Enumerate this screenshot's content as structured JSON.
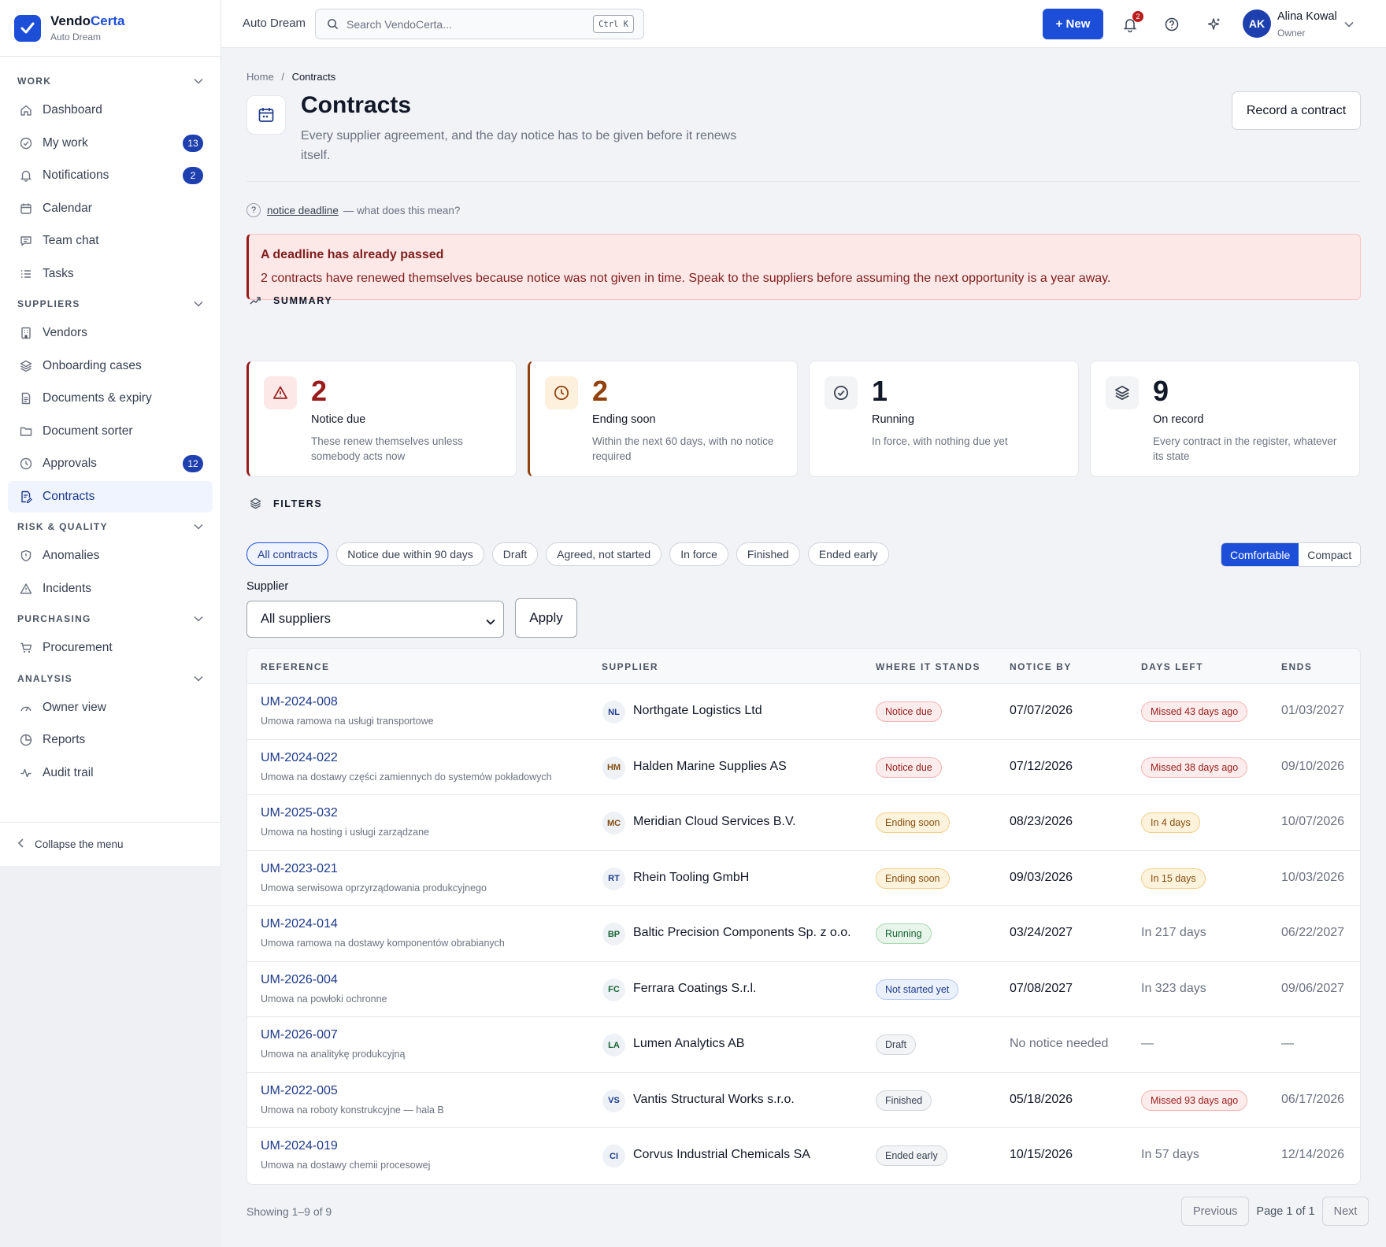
{
  "brand": {
    "name_a": "Vendo",
    "name_b": "Certa",
    "org": "Auto Dream"
  },
  "topbar": {
    "org": "Auto Dream",
    "search_placeholder": "Search VendoCerta...",
    "search_shortcut": "Ctrl K",
    "new_label": "+ New",
    "bell_count": "2",
    "user_initials": "AK",
    "user_name": "Alina Kowal",
    "user_role": "Owner"
  },
  "sidebar": {
    "sections": [
      {
        "label": "WORK",
        "items": [
          {
            "label": "Dashboard",
            "icon": "home-icon"
          },
          {
            "label": "My work",
            "icon": "check-circle-icon",
            "badge": "13"
          },
          {
            "label": "Notifications",
            "icon": "bell-icon",
            "badge": "2"
          },
          {
            "label": "Calendar",
            "icon": "calendar-icon"
          },
          {
            "label": "Team chat",
            "icon": "chat-icon"
          },
          {
            "label": "Tasks",
            "icon": "list-icon"
          }
        ]
      },
      {
        "label": "SUPPLIERS",
        "items": [
          {
            "label": "Vendors",
            "icon": "building-icon"
          },
          {
            "label": "Onboarding cases",
            "icon": "layers-icon"
          },
          {
            "label": "Documents & expiry",
            "icon": "document-icon"
          },
          {
            "label": "Document sorter",
            "icon": "folder-icon"
          },
          {
            "label": "Approvals",
            "icon": "clock-icon",
            "badge": "12"
          },
          {
            "label": "Contracts",
            "icon": "contract-icon",
            "active": true
          }
        ]
      },
      {
        "label": "RISK & QUALITY",
        "items": [
          {
            "label": "Anomalies",
            "icon": "shield-icon"
          },
          {
            "label": "Incidents",
            "icon": "warning-icon"
          }
        ]
      },
      {
        "label": "PURCHASING",
        "items": [
          {
            "label": "Procurement",
            "icon": "cart-icon"
          }
        ]
      },
      {
        "label": "ANALYSIS",
        "items": [
          {
            "label": "Owner view",
            "icon": "gauge-icon"
          },
          {
            "label": "Reports",
            "icon": "pie-icon"
          },
          {
            "label": "Audit trail",
            "icon": "activity-icon"
          }
        ]
      }
    ],
    "collapse_label": "Collapse the menu"
  },
  "page": {
    "breadcrumb_home": "Home",
    "breadcrumb_sep": "/",
    "breadcrumb_current": "Contracts",
    "title": "Contracts",
    "subtitle": "Every supplier agreement, and the day notice has to be given before it renews itself.",
    "record_button": "Record a contract",
    "term_label": "notice deadline",
    "term_hint": "— what does this mean?"
  },
  "alert": {
    "title": "A deadline has already passed",
    "body": "2 contracts have renewed themselves because notice was not given in time. Speak to the suppliers before assuming the next opportunity is a year away."
  },
  "summary": {
    "heading": "SUMMARY",
    "cards": [
      {
        "value": "2",
        "label": "Notice due",
        "desc": "These renew themselves unless somebody acts now",
        "tone": "red",
        "icon": "warning-icon"
      },
      {
        "value": "2",
        "label": "Ending soon",
        "desc": "Within the next 60 days, with no notice required",
        "tone": "amber",
        "icon": "clock-icon"
      },
      {
        "value": "1",
        "label": "Running",
        "desc": "In force, with nothing due yet",
        "tone": "neutral",
        "icon": "check-circle-icon"
      },
      {
        "value": "9",
        "label": "On record",
        "desc": "Every contract in the register, whatever its state",
        "tone": "neutral",
        "icon": "layers-icon"
      }
    ]
  },
  "filters": {
    "heading": "FILTERS",
    "chips": [
      "All contracts",
      "Notice due within 90 days",
      "Draft",
      "Agreed, not started",
      "In force",
      "Finished",
      "Ended early"
    ],
    "active_chip": "All contracts",
    "density": [
      "Comfortable",
      "Compact"
    ],
    "density_selected": "Comfortable",
    "supplier_label": "Supplier",
    "supplier_value": "All suppliers",
    "apply_label": "Apply"
  },
  "table": {
    "columns": [
      "REFERENCE",
      "SUPPLIER",
      "WHERE IT STANDS",
      "NOTICE BY",
      "DAYS LEFT",
      "ENDS"
    ],
    "rows": [
      {
        "ref": "UM-2024-008",
        "desc": "Umowa ramowa na usługi transportowe",
        "initials": "NL",
        "initials_color": "#1e3a8a",
        "supplier": "Northgate Logistics Ltd",
        "status": "Notice due",
        "status_tone": "red",
        "notice": "07/07/2026",
        "days": "Missed 43 days ago",
        "days_tone": "red",
        "ends": "01/03/2027"
      },
      {
        "ref": "UM-2024-022",
        "desc": "Umowa na dostawy części zamiennych do systemów pokładowych",
        "initials": "HM",
        "initials_color": "#854d0e",
        "supplier": "Halden Marine Supplies AS",
        "status": "Notice due",
        "status_tone": "red",
        "notice": "07/12/2026",
        "days": "Missed 38 days ago",
        "days_tone": "red",
        "ends": "09/10/2026"
      },
      {
        "ref": "UM-2025-032",
        "desc": "Umowa na hosting i usługi zarządzane",
        "initials": "MC",
        "initials_color": "#854d0e",
        "supplier": "Meridian Cloud Services B.V.",
        "status": "Ending soon",
        "status_tone": "amber",
        "notice": "08/23/2026",
        "days": "In 4 days",
        "days_tone": "amber",
        "ends": "10/07/2026"
      },
      {
        "ref": "UM-2023-021",
        "desc": "Umowa serwisowa oprzyrządowania produkcyjnego",
        "initials": "RT",
        "initials_color": "#1e3a8a",
        "supplier": "Rhein Tooling GmbH",
        "status": "Ending soon",
        "status_tone": "amber",
        "notice": "09/03/2026",
        "days": "In 15 days",
        "days_tone": "amber",
        "ends": "10/03/2026"
      },
      {
        "ref": "UM-2024-014",
        "desc": "Umowa ramowa na dostawy komponentów obrabianych",
        "initials": "BP",
        "initials_color": "#166534",
        "supplier": "Baltic Precision Components Sp. z o.o.",
        "status": "Running",
        "status_tone": "green",
        "notice": "03/24/2027",
        "days": "In 217 days",
        "days_tone": "plain",
        "ends": "06/22/2027"
      },
      {
        "ref": "UM-2026-004",
        "desc": "Umowa na powłoki ochronne",
        "initials": "FC",
        "initials_color": "#166534",
        "supplier": "Ferrara Coatings S.r.l.",
        "status": "Not started yet",
        "status_tone": "blue",
        "notice": "07/08/2027",
        "days": "In 323 days",
        "days_tone": "plain",
        "ends": "09/06/2027"
      },
      {
        "ref": "UM-2026-007",
        "desc": "Umowa na analitykę produkcyjną",
        "initials": "LA",
        "initials_color": "#166534",
        "supplier": "Lumen Analytics AB",
        "status": "Draft",
        "status_tone": "grey",
        "notice": "No notice needed",
        "notice_muted": true,
        "days": "—",
        "days_tone": "plain",
        "ends": "—"
      },
      {
        "ref": "UM-2022-005",
        "desc": "Umowa na roboty konstrukcyjne — hala B",
        "initials": "VS",
        "initials_color": "#1e3a8a",
        "supplier": "Vantis Structural Works s.r.o.",
        "status": "Finished",
        "status_tone": "grey",
        "notice": "05/18/2026",
        "days": "Missed 93 days ago",
        "days_tone": "red",
        "ends": "06/17/2026"
      },
      {
        "ref": "UM-2024-019",
        "desc": "Umowa na dostawy chemii procesowej",
        "initials": "CI",
        "initials_color": "#1e3a8a",
        "supplier": "Corvus Industrial Chemicals SA",
        "status": "Ended early",
        "status_tone": "grey",
        "notice": "10/15/2026",
        "days": "In 57 days",
        "days_tone": "plain",
        "ends": "12/14/2026"
      }
    ]
  },
  "footer": {
    "showing": "Showing 1–9 of 9",
    "previous": "Previous",
    "page_info": "Page 1 of 1",
    "next": "Next"
  }
}
